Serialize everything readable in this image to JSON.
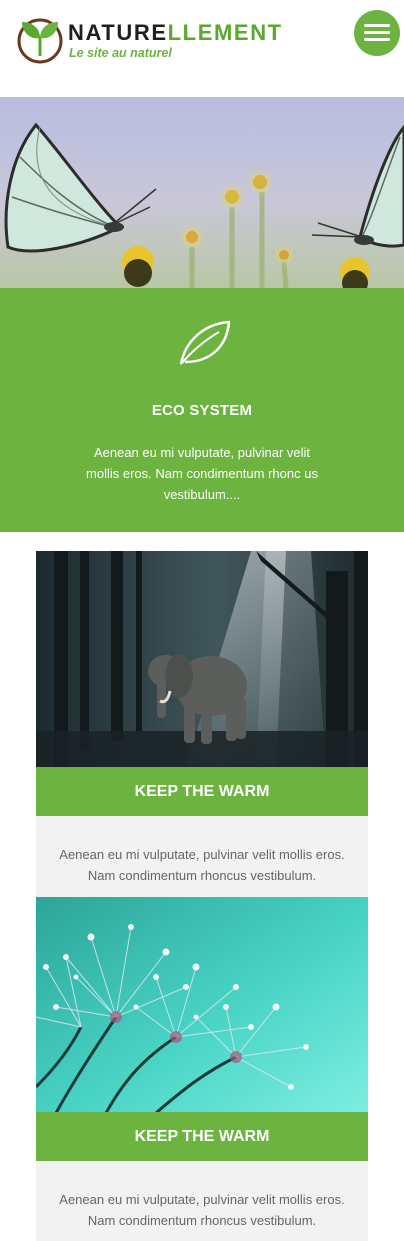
{
  "header": {
    "brand_dark": "NATURE",
    "brand_green": "LLEMENT",
    "tagline": "Le site au naturel",
    "menu_icon": "hamburger-icon",
    "accent_color": "#6cb33f"
  },
  "feature": {
    "icon": "leaf-icon",
    "title": "ECO SYSTEM",
    "text": "Aenean eu mi vulputate, pulvinar velit mollis eros. Nam condimentum rhonc us vestibulum...."
  },
  "cards": [
    {
      "image": "elephant-forest-image",
      "title": "KEEP THE WARM",
      "text": "Aenean eu mi vulputate, pulvinar velit mollis eros. Nam condimentum rhoncus vestibulum."
    },
    {
      "image": "dandelion-dew-image",
      "title": "KEEP THE WARM",
      "text": "Aenean eu mi vulputate, pulvinar velit mollis eros. Nam condimentum rhoncus vestibulum."
    }
  ]
}
